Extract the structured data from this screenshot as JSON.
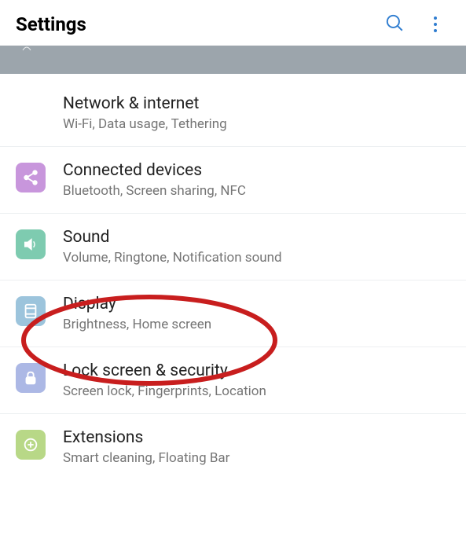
{
  "header": {
    "title": "Settings"
  },
  "items": [
    {
      "id": "network",
      "title": "Network & internet",
      "subtitle": "Wi-Fi, Data usage, Tethering",
      "iconColor": "#f5b84a",
      "iconName": "wifi-icon"
    },
    {
      "id": "connected",
      "title": "Connected devices",
      "subtitle": "Bluetooth, Screen sharing, NFC",
      "iconColor": "#c896dc",
      "iconName": "share-icon"
    },
    {
      "id": "sound",
      "title": "Sound",
      "subtitle": "Volume, Ringtone, Notification sound",
      "iconColor": "#7ecbb0",
      "iconName": "sound-icon"
    },
    {
      "id": "display",
      "title": "Display",
      "subtitle": "Brightness, Home screen",
      "iconColor": "#9cc4dc",
      "iconName": "display-icon"
    },
    {
      "id": "lockscreen",
      "title": "Lock screen & security",
      "subtitle": "Screen lock, Fingerprints, Location",
      "iconColor": "#acb8e5",
      "iconName": "lock-icon"
    },
    {
      "id": "extensions",
      "title": "Extensions",
      "subtitle": "Smart cleaning, Floating Bar",
      "iconColor": "#b8d887",
      "iconName": "extensions-icon"
    }
  ],
  "annotations": {
    "circledItem": "display"
  }
}
